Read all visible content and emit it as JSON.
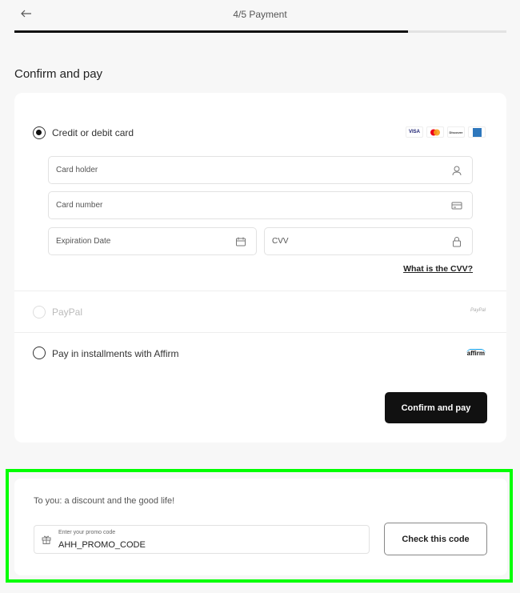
{
  "header": {
    "step_title": "4/5 Payment",
    "progress_fraction": 0.8
  },
  "page_title": "Confirm and pay",
  "payment": {
    "credit": {
      "label": "Credit or debit card",
      "selected": true,
      "brands": [
        "VISA",
        "Mastercard",
        "Discover",
        "Amex"
      ],
      "fields": {
        "card_holder": "Card holder",
        "card_number": "Card number",
        "expiration": "Expiration Date",
        "cvv": "CVV"
      },
      "cvv_link": "What is the CVV?"
    },
    "paypal": {
      "label": "PayPal",
      "logo": "PayPal",
      "disabled": true
    },
    "affirm": {
      "label": "Pay in installments with Affirm",
      "logo": "affirm"
    },
    "confirm_label": "Confirm and pay"
  },
  "promo": {
    "text": "To you: a discount and the good life!",
    "field_label": "Enter your promo code",
    "field_value": "AHH_PROMO_CODE",
    "button_label": "Check this code"
  },
  "colors": {
    "highlight": "#00ff00",
    "primary_button": "#111111"
  }
}
